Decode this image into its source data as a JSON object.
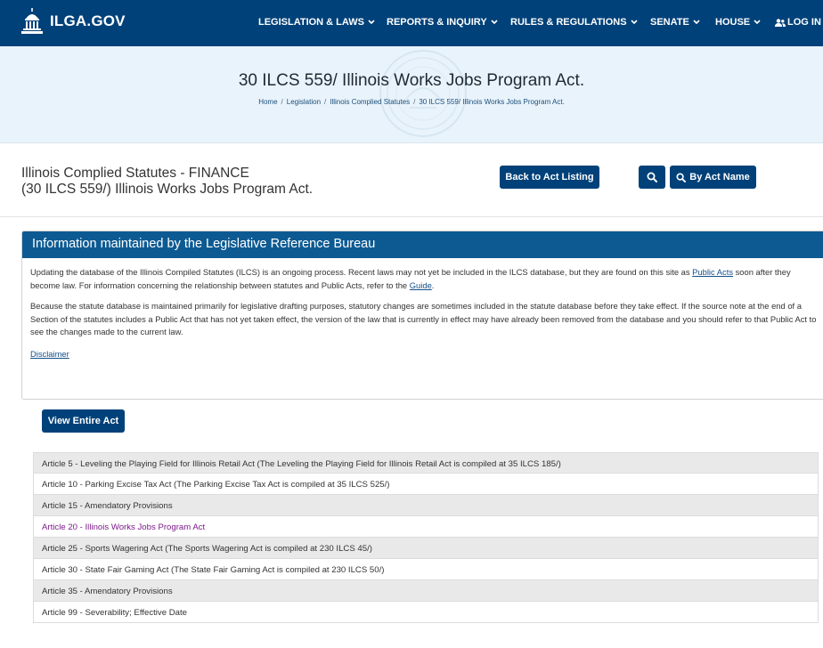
{
  "nav": {
    "brand": "ILGA.GOV",
    "items": [
      {
        "label": "LEGISLATION & LAWS",
        "has_dropdown": true
      },
      {
        "label": "REPORTS & INQUIRY",
        "has_dropdown": true
      },
      {
        "label": "RULES & REGULATIONS",
        "has_dropdown": true
      },
      {
        "label": "SENATE",
        "has_dropdown": true
      },
      {
        "label": "HOUSE",
        "has_dropdown": true
      }
    ],
    "login": "LOG IN",
    "brand_icon": "capitol-building-icon",
    "login_icon": "users-icon"
  },
  "hero": {
    "title": "30 ILCS 559/ Illinois Works Jobs Program Act.",
    "breadcrumb": [
      "Home",
      "Legislation",
      "Illinois Complied Statutes",
      "30 ILCS 559/ Illinois Works Jobs Program Act."
    ],
    "seal_icon": "state-seal-watermark"
  },
  "act": {
    "line1": "Illinois Complied Statutes - FINANCE",
    "line2": "(30 ILCS 559/) Illinois Works Jobs Program Act.",
    "back_button": "Back to Act Listing",
    "search_icon": "search-icon",
    "by_name_button": "By Act Name"
  },
  "info": {
    "header": "Information maintained by the Legislative Reference Bureau",
    "p1_before": "Updating the database of the Illinois Compiled Statutes (ILCS) is an ongoing process. Recent laws may not yet be included in the ILCS database, but they are found on this site as ",
    "p1_link1": "Public Acts",
    "p1_middle": " soon after they become law. For information concerning the relationship between statutes and Public Acts, refer to the ",
    "p1_link2": "Guide",
    "p1_end": ".",
    "p2": "Because the statute database is maintained primarily for legislative drafting purposes, statutory changes are sometimes included in the statute database before they take effect. If the source note at the end of a Section of the statutes includes a Public Act that has not yet taken effect, the version of the law that is currently in effect may have already been removed from the database and you should refer to that Public Act to see the changes made to the current law.",
    "disclaimer": "Disclaimer"
  },
  "view_entire": "View Entire Act",
  "articles": [
    "Article 5 - Leveling the Playing Field for Illinois Retail Act (The Leveling the Playing Field for Illinois Retail Act is compiled at 35 ILCS 185/)",
    "Article 10 - Parking Excise Tax Act (The Parking Excise Tax Act is compiled at 35 ILCS 525/)",
    "Article 15 - Amendatory Provisions",
    "Article 20 - Illinois Works Jobs Program Act",
    "Article 25 - Sports Wagering Act (The Sports Wagering Act is compiled at 230 ILCS 45/)",
    "Article 30 - State Fair Gaming Act (The State Fair Gaming Act is compiled at 230 ILCS 50/)",
    "Article 35 - Amendatory Provisions",
    "Article 99 - Severability; Effective Date"
  ],
  "colors": {
    "nav_bg": "#004179",
    "hero_bg": "#e9f3fb",
    "panel_header": "#0d5a93",
    "visited_link": "#7b1a89"
  }
}
